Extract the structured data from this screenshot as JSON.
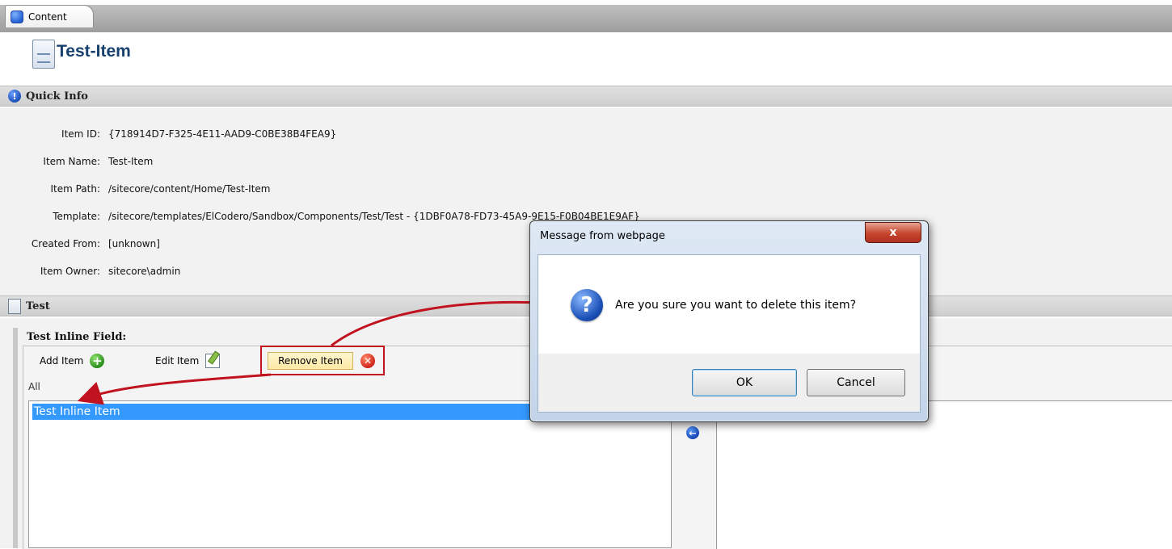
{
  "tab": {
    "label": "Content"
  },
  "item": {
    "title": "Test-Item"
  },
  "quick_info": {
    "heading": "Quick Info",
    "fields": [
      {
        "label": "Item ID:",
        "value": "{718914D7-F325-4E11-AAD9-C0BE38B4FEA9}"
      },
      {
        "label": "Item Name:",
        "value": "Test-Item"
      },
      {
        "label": "Item Path:",
        "value": "/sitecore/content/Home/Test-Item"
      },
      {
        "label": "Template:",
        "value": "/sitecore/templates/ElCodero/Sandbox/Components/Test/Test - {1DBF0A78-FD73-45A9-9E15-F0B04BE1E9AF}"
      },
      {
        "label": "Created From:",
        "value": "[unknown]"
      },
      {
        "label": "Item Owner:",
        "value": "sitecore\\admin"
      }
    ]
  },
  "test_section": {
    "heading": "Test",
    "field_label": "Test Inline Field:",
    "toolbar": {
      "add_label": "Add Item",
      "edit_label": "Edit Item",
      "remove_label": "Remove Item"
    },
    "filter_label": "All",
    "list_items": [
      "Test Inline Item"
    ]
  },
  "dialog": {
    "title": "Message from webpage",
    "message": "Are you sure you want to delete this item?",
    "ok_label": "OK",
    "cancel_label": "Cancel",
    "close_glyph": "x",
    "icon": "question-icon"
  },
  "colors": {
    "title_blue": "#17406d",
    "selection_blue": "#3399ff",
    "annotation_red": "#c1121f"
  }
}
